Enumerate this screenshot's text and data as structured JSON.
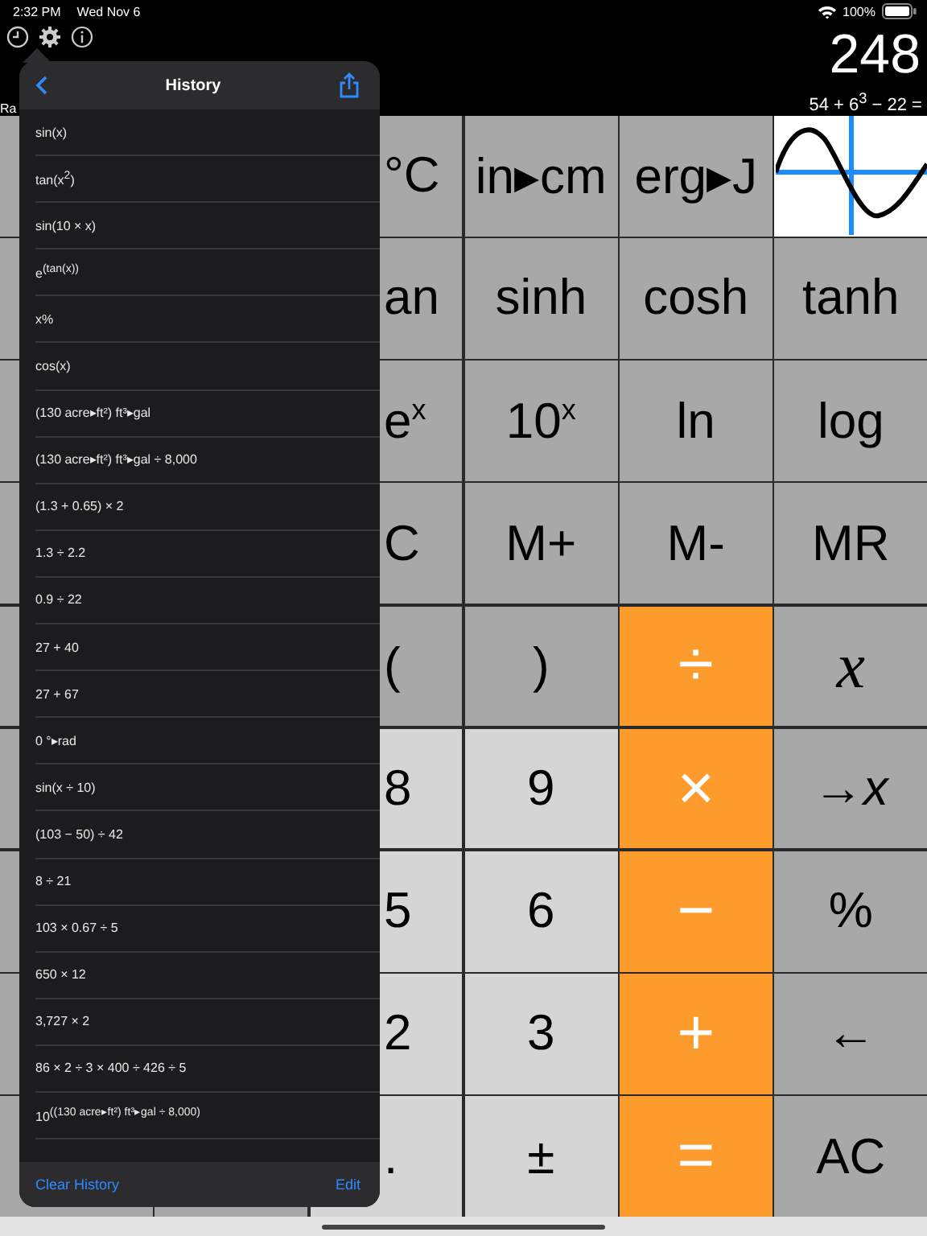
{
  "status_bar": {
    "time": "2:32 PM",
    "date": "Wed Nov 6",
    "battery": "100%"
  },
  "display": {
    "value": "248",
    "expression": "54 + 6$^{3}$ − 22 =",
    "mode": "Ra"
  },
  "history": {
    "title": "History",
    "items": [
      "sin(x)",
      "tan(x$^{2}$)",
      "sin(10 × x)",
      "e$^{(tan(x))}$",
      "x%",
      "cos(x)",
      "(130 acre▸ft²) ft³▸gal",
      "(130 acre▸ft²) ft³▸gal ÷ 8,000",
      "(1.3 + 0.65) × 2",
      "1.3 ÷ 2.2",
      "0.9 ÷ 22",
      "27 + 40",
      "27 + 67",
      "0 °▸rad",
      "sin(x ÷ 10)",
      "(103 − 50) ÷ 42",
      "8 ÷ 21",
      "103 × 0.67 ÷ 5",
      "650 × 12",
      "3,727 × 2",
      "86 × 2 ÷ 3 × 400 ÷ 426 ÷ 5",
      "10$^{((130 acre▸ft²) ft³▸gal ÷ 8,000)}$"
    ],
    "clear_button": "Clear History",
    "edit_button": "Edit"
  },
  "keypad": [
    {
      "keys": [
        {
          "kind": "fn",
          "label": "°C"
        },
        {
          "kind": "fn",
          "label": "in▸cm"
        },
        {
          "kind": "fn",
          "label": "erg▸J"
        },
        {
          "kind": "graph"
        }
      ]
    },
    {
      "keys": [
        {
          "kind": "fn",
          "label": "an"
        },
        {
          "kind": "fn",
          "label": "sinh"
        },
        {
          "kind": "fn",
          "label": "cosh"
        },
        {
          "kind": "fn",
          "label": "tanh"
        }
      ]
    },
    {
      "keys": [
        {
          "kind": "fn",
          "label": "e$^{x}$"
        },
        {
          "kind": "fn",
          "label": "10$^{x}$"
        },
        {
          "kind": "fn",
          "label": "ln"
        },
        {
          "kind": "fn",
          "label": "log"
        }
      ]
    },
    {
      "keys": [
        {
          "kind": "fn",
          "label": "C"
        },
        {
          "kind": "fn",
          "label": "M+"
        },
        {
          "kind": "fn",
          "label": "M-"
        },
        {
          "kind": "fn",
          "label": "MR"
        }
      ]
    },
    {
      "keys": [
        {
          "kind": "fn",
          "label": "("
        },
        {
          "kind": "fn",
          "label": ")"
        },
        {
          "kind": "op",
          "label": "÷"
        },
        {
          "kind": "var",
          "label": "x"
        }
      ]
    },
    {
      "keys": [
        {
          "kind": "num",
          "label": "8"
        },
        {
          "kind": "num",
          "label": "9"
        },
        {
          "kind": "op",
          "label": "×"
        },
        {
          "kind": "fn",
          "label": "→*x*"
        }
      ]
    },
    {
      "keys": [
        {
          "kind": "num",
          "label": "5"
        },
        {
          "kind": "num",
          "label": "6"
        },
        {
          "kind": "op",
          "label": "−"
        },
        {
          "kind": "fn",
          "label": "%"
        }
      ]
    },
    {
      "keys": [
        {
          "kind": "num",
          "label": "2"
        },
        {
          "kind": "num",
          "label": "3"
        },
        {
          "kind": "op",
          "label": "+"
        },
        {
          "kind": "fn",
          "label": "←"
        }
      ]
    },
    {
      "keys": [
        {
          "kind": "num",
          "label": "."
        },
        {
          "kind": "num",
          "label": "±"
        },
        {
          "kind": "op",
          "label": "="
        },
        {
          "kind": "fn",
          "label": "AC"
        }
      ]
    }
  ]
}
